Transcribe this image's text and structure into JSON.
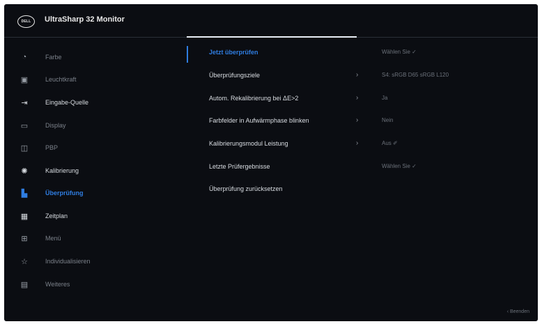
{
  "header": {
    "logo_text": "DELL",
    "title": "UltraSharp 32 Monitor"
  },
  "sidebar": {
    "items": [
      {
        "label": "Farbe",
        "icon": "color-palette-icon",
        "glyph": "◔",
        "state": "dim"
      },
      {
        "label": "Leuchtkraft",
        "icon": "brightness-icon",
        "glyph": "▣",
        "state": "dim"
      },
      {
        "label": "Eingabe-Quelle",
        "icon": "input-source-icon",
        "glyph": "⇥",
        "state": "bright"
      },
      {
        "label": "Display",
        "icon": "display-icon",
        "glyph": "▭",
        "state": "dim"
      },
      {
        "label": "PBP",
        "icon": "pbp-icon",
        "glyph": "◫",
        "state": "dim"
      },
      {
        "label": "Kalibrierung",
        "icon": "calibration-icon",
        "glyph": "✺",
        "state": "bright"
      },
      {
        "label": "Überprüfung",
        "icon": "validation-icon",
        "glyph": "▙",
        "state": "active"
      },
      {
        "label": "Zeitplan",
        "icon": "schedule-icon",
        "glyph": "▦",
        "state": "bright"
      },
      {
        "label": "Menü",
        "icon": "menu-icon",
        "glyph": "⊞",
        "state": "dim"
      },
      {
        "label": "Individualisieren",
        "icon": "star-icon",
        "glyph": "☆",
        "state": "dim"
      },
      {
        "label": "Weiteres",
        "icon": "others-icon",
        "glyph": "▤",
        "state": "dim"
      }
    ]
  },
  "main": {
    "rows": [
      {
        "label": "Jetzt überprüfen",
        "chevron": "",
        "value": "Wählen Sie ✓",
        "active": true
      },
      {
        "label": "Überprüfungsziele",
        "chevron": "›",
        "value": "S4: sRGB D65 sRGB L120"
      },
      {
        "label": "Autom. Rekalibrierung bei ΔE>2",
        "chevron": "›",
        "value": "Ja"
      },
      {
        "label": "Farbfelder in Aufwärmphase blinken",
        "chevron": "›",
        "value": "Nein"
      },
      {
        "label": "Kalibrierungsmodul Leistung",
        "chevron": "›",
        "value": "Aus ✐"
      },
      {
        "label": "Letzte Prüfergebnisse",
        "chevron": "",
        "value": "Wählen Sie ✓"
      },
      {
        "label": "Überprüfung zurücksetzen",
        "chevron": "",
        "value": ""
      }
    ]
  },
  "footer": {
    "hint": "‹ Beenden"
  }
}
